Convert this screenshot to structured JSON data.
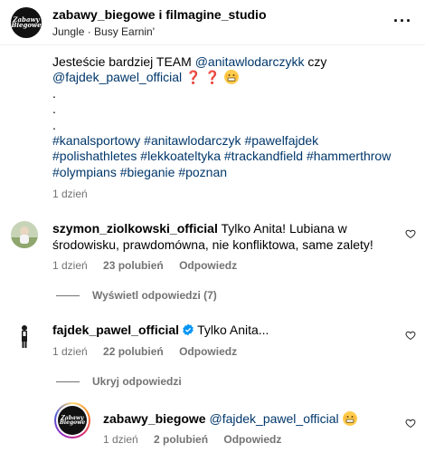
{
  "header": {
    "username": "zabawy_biegowe i filmagine_studio",
    "audio": "Jungle · Busy Earnin'",
    "avatar_text": "Zabawy Biegowe"
  },
  "caption": {
    "line1_text": "Jesteście bardziej TEAM ",
    "line1_mention": "@anitawlodarczykk",
    "line1_after": " czy",
    "line2_mention": "@fajdek_pawel_official",
    "line2_marks": " ❓ ❓",
    "dots": [
      ".",
      ".",
      "."
    ],
    "hashtags_lines": [
      "#kanalsportowy #anitawlodarczyk #pawelfajdek",
      "#polishathletes #lekkoateltyka #trackandfield #hammerthrow",
      "#olympians #bieganie #poznan"
    ],
    "time": "1 dzień"
  },
  "comments": [
    {
      "username": "szymon_ziolkowski_official",
      "text_line1": " Tylko Anita! Lubiana w",
      "text_line2": "środowisku, prawdomówna, nie konfliktowa, same zalety!",
      "time": "1 dzień",
      "likes": "23 polubień",
      "reply": "Odpowiedz",
      "view_replies": "Wyświetl odpowiedzi (7)"
    },
    {
      "username": "fajdek_pawel_official",
      "text": "Tylko Anita...",
      "time": "1 dzień",
      "likes": "22 polubień",
      "reply": "Odpowiedz",
      "hide_replies": "Ukryj odpowiedzi"
    },
    {
      "username": "zabawy_biegowe",
      "mention": "@fajdek_pawel_official",
      "time": "1 dzień",
      "likes": "2 polubień",
      "reply": "Odpowiedz"
    }
  ],
  "colors": {
    "link": "#00376b",
    "meta": "#737373",
    "verified": "#0095f6"
  }
}
